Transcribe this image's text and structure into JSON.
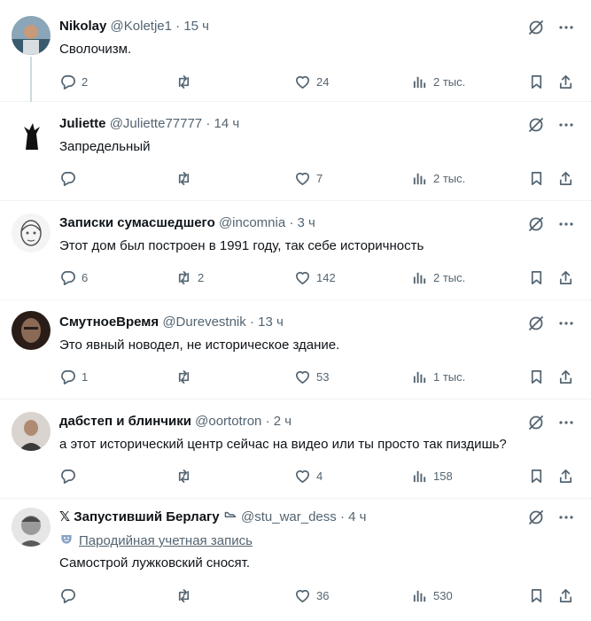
{
  "posts": [
    {
      "name": "Nikolay",
      "handle": "@Koletje1",
      "time": "15 ч",
      "text": "Сволочизм.",
      "counts": {
        "reply": "2",
        "repost": "",
        "like": "24",
        "views": "2 тыс."
      }
    },
    {
      "name": "Juliette",
      "handle": "@Juliette77777",
      "time": "14 ч",
      "text": "Запредельный",
      "counts": {
        "reply": "",
        "repost": "",
        "like": "7",
        "views": "2 тыс."
      }
    },
    {
      "name": "Записки сумасшедшего",
      "handle": "@incomnia",
      "time": "3 ч",
      "text": "Этот дом был построен в 1991 году, так себе историчность",
      "counts": {
        "reply": "6",
        "repost": "2",
        "like": "142",
        "views": "2 тыс."
      }
    },
    {
      "name": "СмутноеВремя",
      "handle": "@Durevestnik",
      "time": "13 ч",
      "text": "Это явный новодел, не историческое здание.",
      "counts": {
        "reply": "1",
        "repost": "",
        "like": "53",
        "views": "1 тыс."
      }
    },
    {
      "name": "дабстеп и блинчики",
      "handle": "@oortotron",
      "time": "2 ч",
      "text": "а этот исторический центр сейчас на видео или ты просто так пиздишь?",
      "counts": {
        "reply": "",
        "repost": "",
        "like": "4",
        "views": "158"
      }
    },
    {
      "name": "𝕏 Запустивший Берлагу",
      "handle": "@stu_war_dess",
      "time": "4 ч",
      "parody_label": "Пародийная учетная запись",
      "text": "Самострой лужковский сносят.",
      "counts": {
        "reply": "",
        "repost": "",
        "like": "36",
        "views": "530"
      }
    }
  ],
  "separator": "·",
  "icons": [
    "grok-icon",
    "more-icon",
    "reply-icon",
    "repost-icon",
    "like-icon",
    "views-icon",
    "bookmark-icon",
    "share-icon",
    "parody-mask-icon",
    "shoe-icon"
  ],
  "colors": {
    "text": "#0f1419",
    "secondary": "#536471",
    "divider": "#eff3f4",
    "thread": "#cfd9de"
  }
}
